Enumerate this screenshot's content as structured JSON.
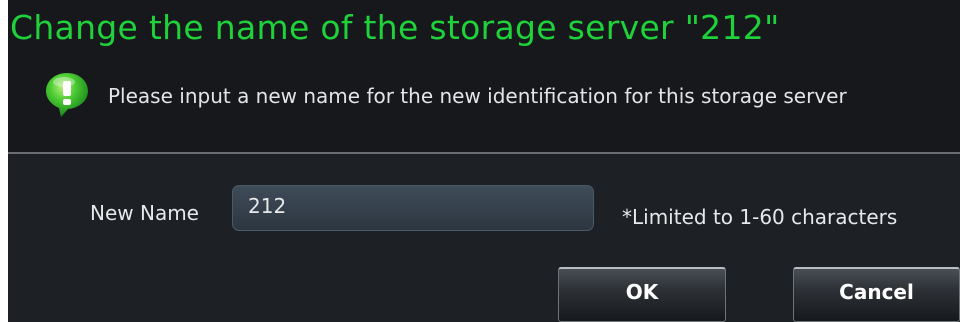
{
  "dialog": {
    "title": "Change the name of the storage server \"212\"",
    "message": "Please input a new name for the new identification for this storage server",
    "icon": "info-exclamation-icon",
    "colors": {
      "title": "#1fd13a",
      "icon": "#33c22c",
      "background": "#1d2024"
    }
  },
  "form": {
    "new_name_label": "New Name",
    "new_name_value": "212",
    "hint": "*Limited to 1-60 characters"
  },
  "buttons": {
    "ok_label": "OK",
    "cancel_label": "Cancel"
  }
}
